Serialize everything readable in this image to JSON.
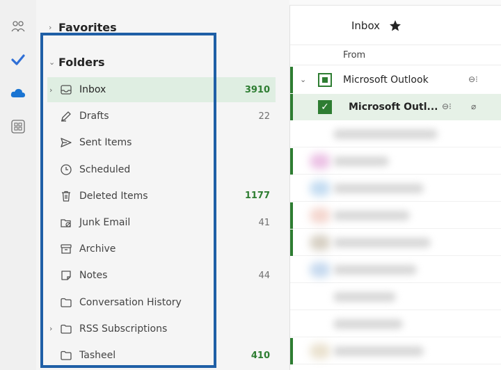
{
  "favorites": {
    "label": "Favorites"
  },
  "folders": {
    "label": "Folders",
    "items": [
      {
        "name": "Inbox",
        "count": "3910",
        "unread": true,
        "selected": true,
        "expandable": true,
        "icon": "inbox-icon"
      },
      {
        "name": "Drafts",
        "count": "22",
        "unread": false,
        "icon": "drafts-icon"
      },
      {
        "name": "Sent Items",
        "count": "",
        "unread": false,
        "icon": "send-icon"
      },
      {
        "name": "Scheduled",
        "count": "",
        "unread": false,
        "icon": "clock-icon"
      },
      {
        "name": "Deleted Items",
        "count": "1177",
        "unread": true,
        "icon": "trash-icon"
      },
      {
        "name": "Junk Email",
        "count": "41",
        "unread": false,
        "icon": "junk-icon"
      },
      {
        "name": "Archive",
        "count": "",
        "unread": false,
        "icon": "archive-icon"
      },
      {
        "name": "Notes",
        "count": "44",
        "unread": false,
        "icon": "note-icon"
      },
      {
        "name": "Conversation History",
        "count": "",
        "unread": false,
        "icon": "folder-icon"
      },
      {
        "name": "RSS Subscriptions",
        "count": "",
        "unread": false,
        "expandable": true,
        "icon": "folder-icon"
      },
      {
        "name": "Tasheel",
        "count": "410",
        "unread": true,
        "icon": "folder-icon"
      }
    ]
  },
  "message_list": {
    "title": "Inbox",
    "column_from": "From",
    "rows": [
      {
        "sender": "Microsoft Outlook"
      },
      {
        "sender": "Microsoft Outl..."
      }
    ]
  },
  "colors": {
    "accent": "#2e7d32",
    "highlight_border": "#1f5fa6",
    "selected_bg": "#dfeee2"
  }
}
